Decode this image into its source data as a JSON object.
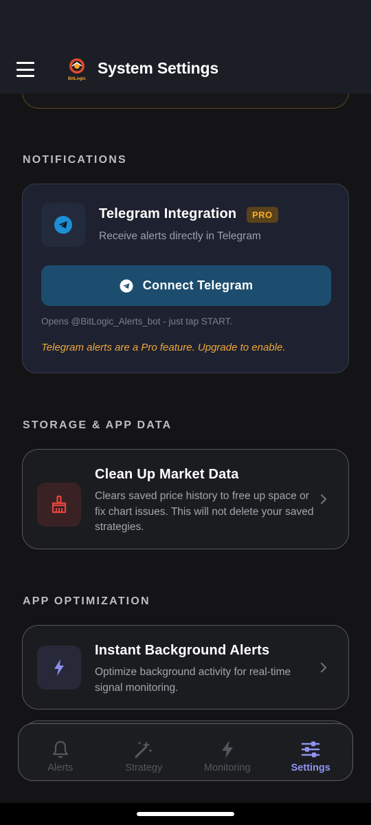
{
  "header": {
    "title": "System Settings",
    "logo_text": "BitLogic"
  },
  "sections": {
    "notifications": "NOTIFICATIONS",
    "storage": "STORAGE & APP DATA",
    "optimization": "APP OPTIMIZATION"
  },
  "telegram": {
    "title": "Telegram Integration",
    "badge": "PRO",
    "subtitle": "Receive alerts directly in Telegram",
    "button_label": "Connect Telegram",
    "hint": "Opens @BitLogic_Alerts_bot - just tap START.",
    "warning": "Telegram alerts are a Pro feature. Upgrade to enable."
  },
  "cleanup": {
    "title": "Clean Up Market Data",
    "description": "Clears saved price history to free up space or fix chart issues. This will not delete your saved strategies."
  },
  "background_alerts": {
    "title": "Instant Background Alerts",
    "description": "Optimize background activity for real-time signal monitoring."
  },
  "nav": {
    "items": [
      {
        "label": "Alerts",
        "icon": "bell-icon"
      },
      {
        "label": "Strategy",
        "icon": "magic-wand-icon"
      },
      {
        "label": "Monitoring",
        "icon": "lightning-icon"
      },
      {
        "label": "Settings",
        "icon": "sliders-icon"
      }
    ],
    "active": "Settings"
  },
  "colors": {
    "accent": "#8f93f2",
    "pro": "#f6ad2f",
    "telegram": "#1c8fd6",
    "danger": "#e8443f"
  }
}
